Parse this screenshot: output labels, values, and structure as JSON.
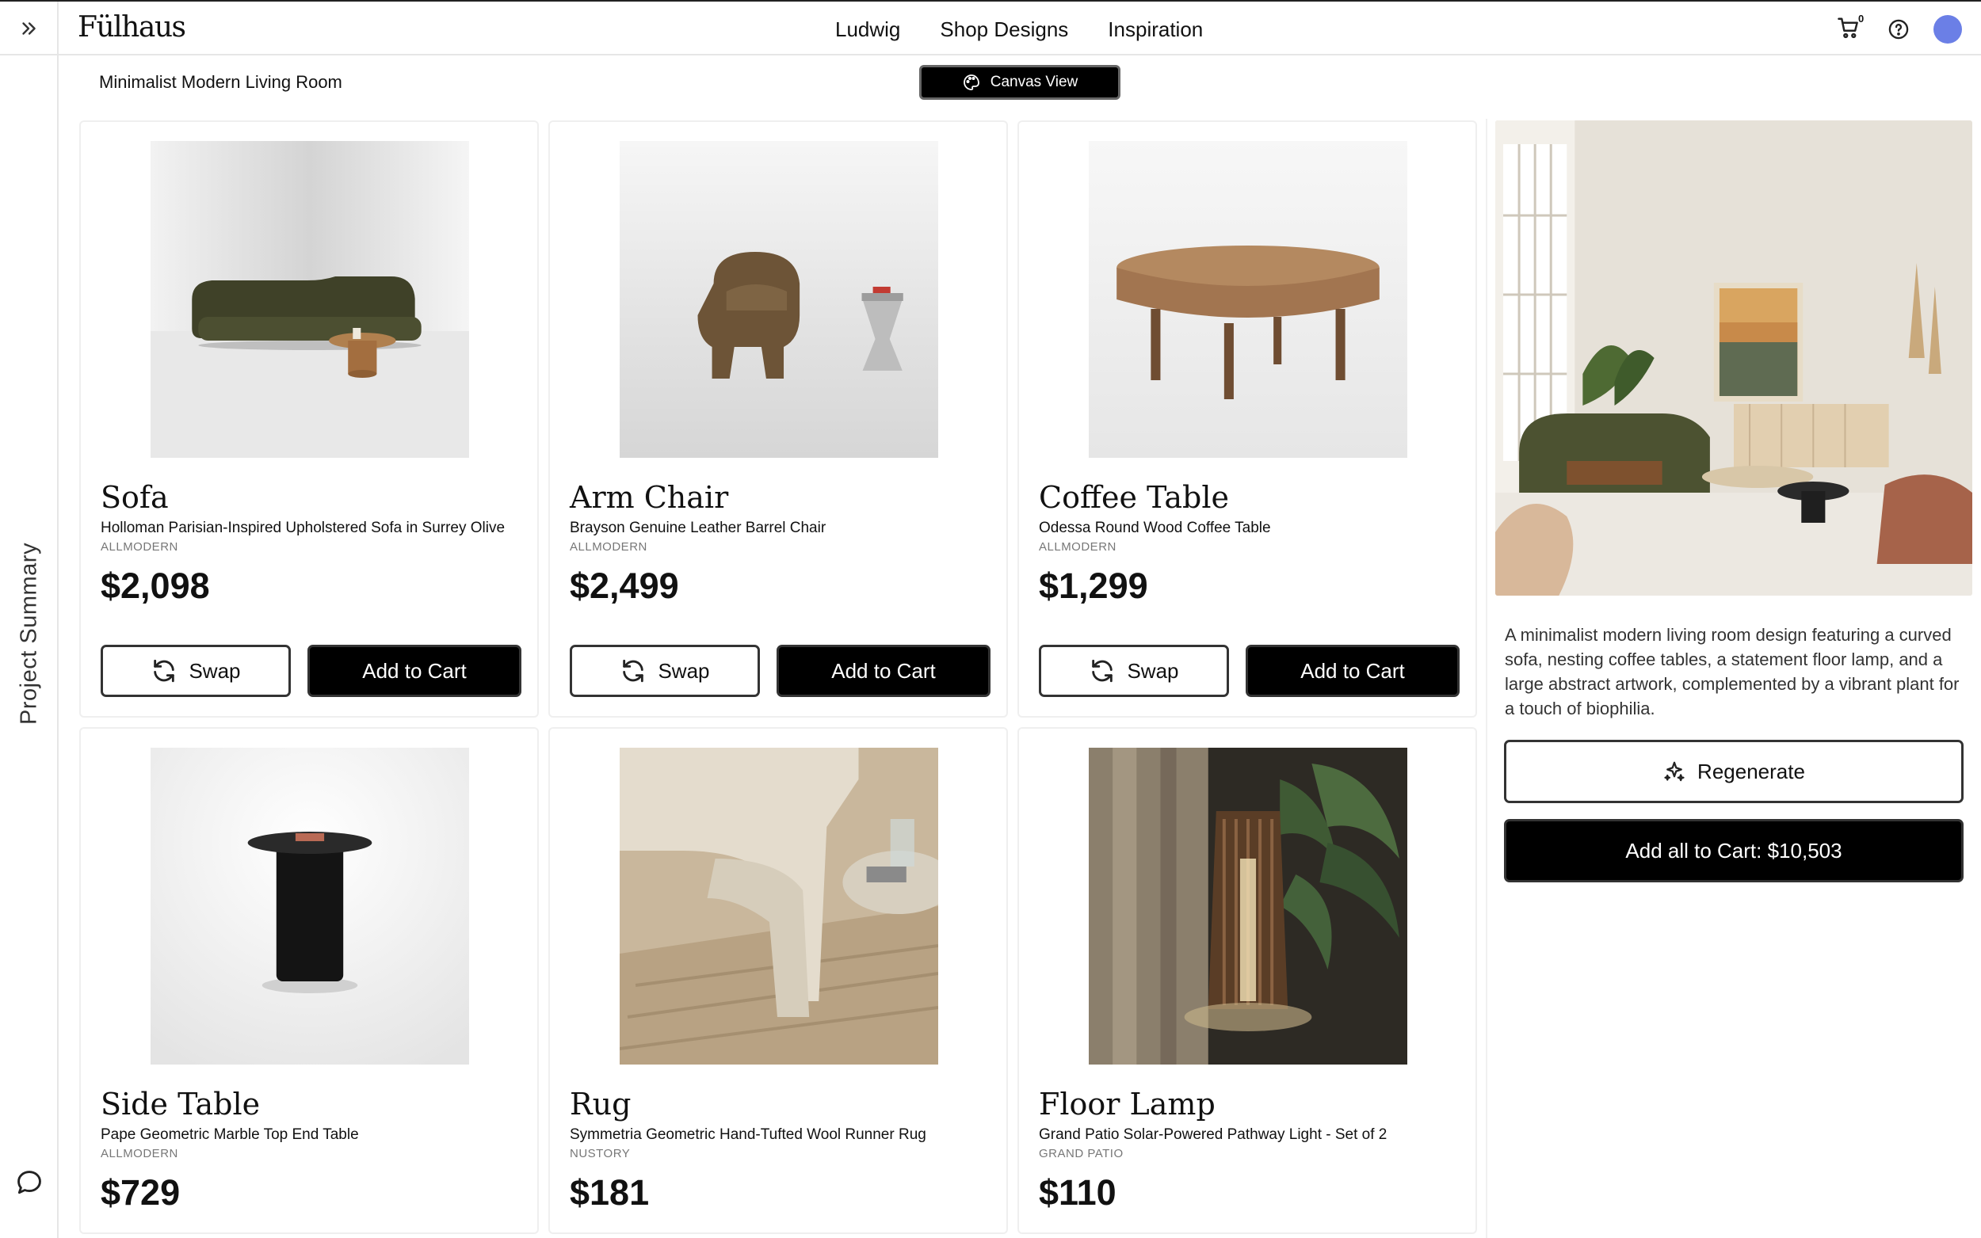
{
  "app": {
    "logo": "Fülhaus"
  },
  "nav": {
    "items": [
      "Ludwig",
      "Shop Designs",
      "Inspiration"
    ]
  },
  "header": {
    "cart_count": "0",
    "cart_icon": "cart-icon",
    "help_icon": "help-icon",
    "avatar_color": "#6b7fe6"
  },
  "sidebar": {
    "label": "Project Summary",
    "expand_icon": "double-chevron-right-icon",
    "chat_icon": "chat-bubble-icon"
  },
  "project": {
    "title": "Minimalist Modern Living Room",
    "canvas_view_label": "Canvas View"
  },
  "buttons": {
    "swap": "Swap",
    "add_to_cart": "Add to Cart"
  },
  "products": [
    {
      "category": "Sofa",
      "name": "Holloman Parisian-Inspired Upholstered Sofa in Surrey Olive",
      "brand": "ALLMODERN",
      "price": "$2,098"
    },
    {
      "category": "Arm Chair",
      "name": "Brayson Genuine Leather Barrel Chair",
      "brand": "ALLMODERN",
      "price": "$2,499"
    },
    {
      "category": "Coffee Table",
      "name": "Odessa Round Wood Coffee Table",
      "brand": "ALLMODERN",
      "price": "$1,299"
    },
    {
      "category": "Side Table",
      "name": "Pape Geometric Marble Top End Table",
      "brand": "ALLMODERN",
      "price": "$729"
    },
    {
      "category": "Rug",
      "name": "Symmetria Geometric Hand-Tufted Wool Runner Rug",
      "brand": "NUSTORY",
      "price": "$181"
    },
    {
      "category": "Floor Lamp",
      "name": "Grand Patio Solar-Powered Pathway Light - Set of 2",
      "brand": "GRAND PATIO",
      "price": "$110"
    }
  ],
  "summary": {
    "description": "A minimalist modern living room design featuring a curved sofa, nesting coffee tables, a statement floor lamp, and a large abstract artwork, complemented by a vibrant plant for a touch of biophilia.",
    "regenerate_label": "Regenerate",
    "add_all_label": "Add all to Cart: $10,503"
  }
}
